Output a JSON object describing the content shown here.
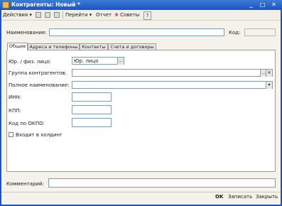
{
  "window": {
    "title": "Контрагенты: Новый *"
  },
  "title_buttons": {
    "minimize": "_",
    "maximize": "□",
    "close": "✕"
  },
  "toolbar": {
    "actions_label": "Действия",
    "goto_label": "Перейти",
    "report_label": "Отчет",
    "tips_label": "Советы",
    "help_label": "?"
  },
  "form": {
    "name_label": "Наименование:",
    "name_value": "",
    "code_label": "Код:",
    "code_value": ""
  },
  "tabs": [
    {
      "label": "Общие",
      "active": true
    },
    {
      "label": "Адреса и телефоны",
      "active": false
    },
    {
      "label": "Контакты",
      "active": false
    },
    {
      "label": "Счета и договоры",
      "active": false
    }
  ],
  "general": {
    "entity_type_label": "Юр. / физ. лицо:",
    "entity_type_value": "Юр. лицо",
    "group_label": "Группа контрагентов:",
    "group_value": "",
    "full_name_label": "Полное наименование:",
    "full_name_value": "",
    "inn_label": "ИНН:",
    "inn_value": "",
    "kpp_label": "КПП:",
    "kpp_value": "",
    "okpo_label": "Код по ОКПО:",
    "okpo_value": "",
    "holding_label": "Входит в холдинг",
    "holding_checked": false
  },
  "comment": {
    "label": "Комментарий:",
    "value": ""
  },
  "bottom_buttons": {
    "ok": "OK",
    "save": "Записать",
    "close": "Закрыть"
  },
  "colors": {
    "title_bar": "#1b53c4",
    "window_bg": "#f4f2ea",
    "input_border": "#7f9db9"
  }
}
